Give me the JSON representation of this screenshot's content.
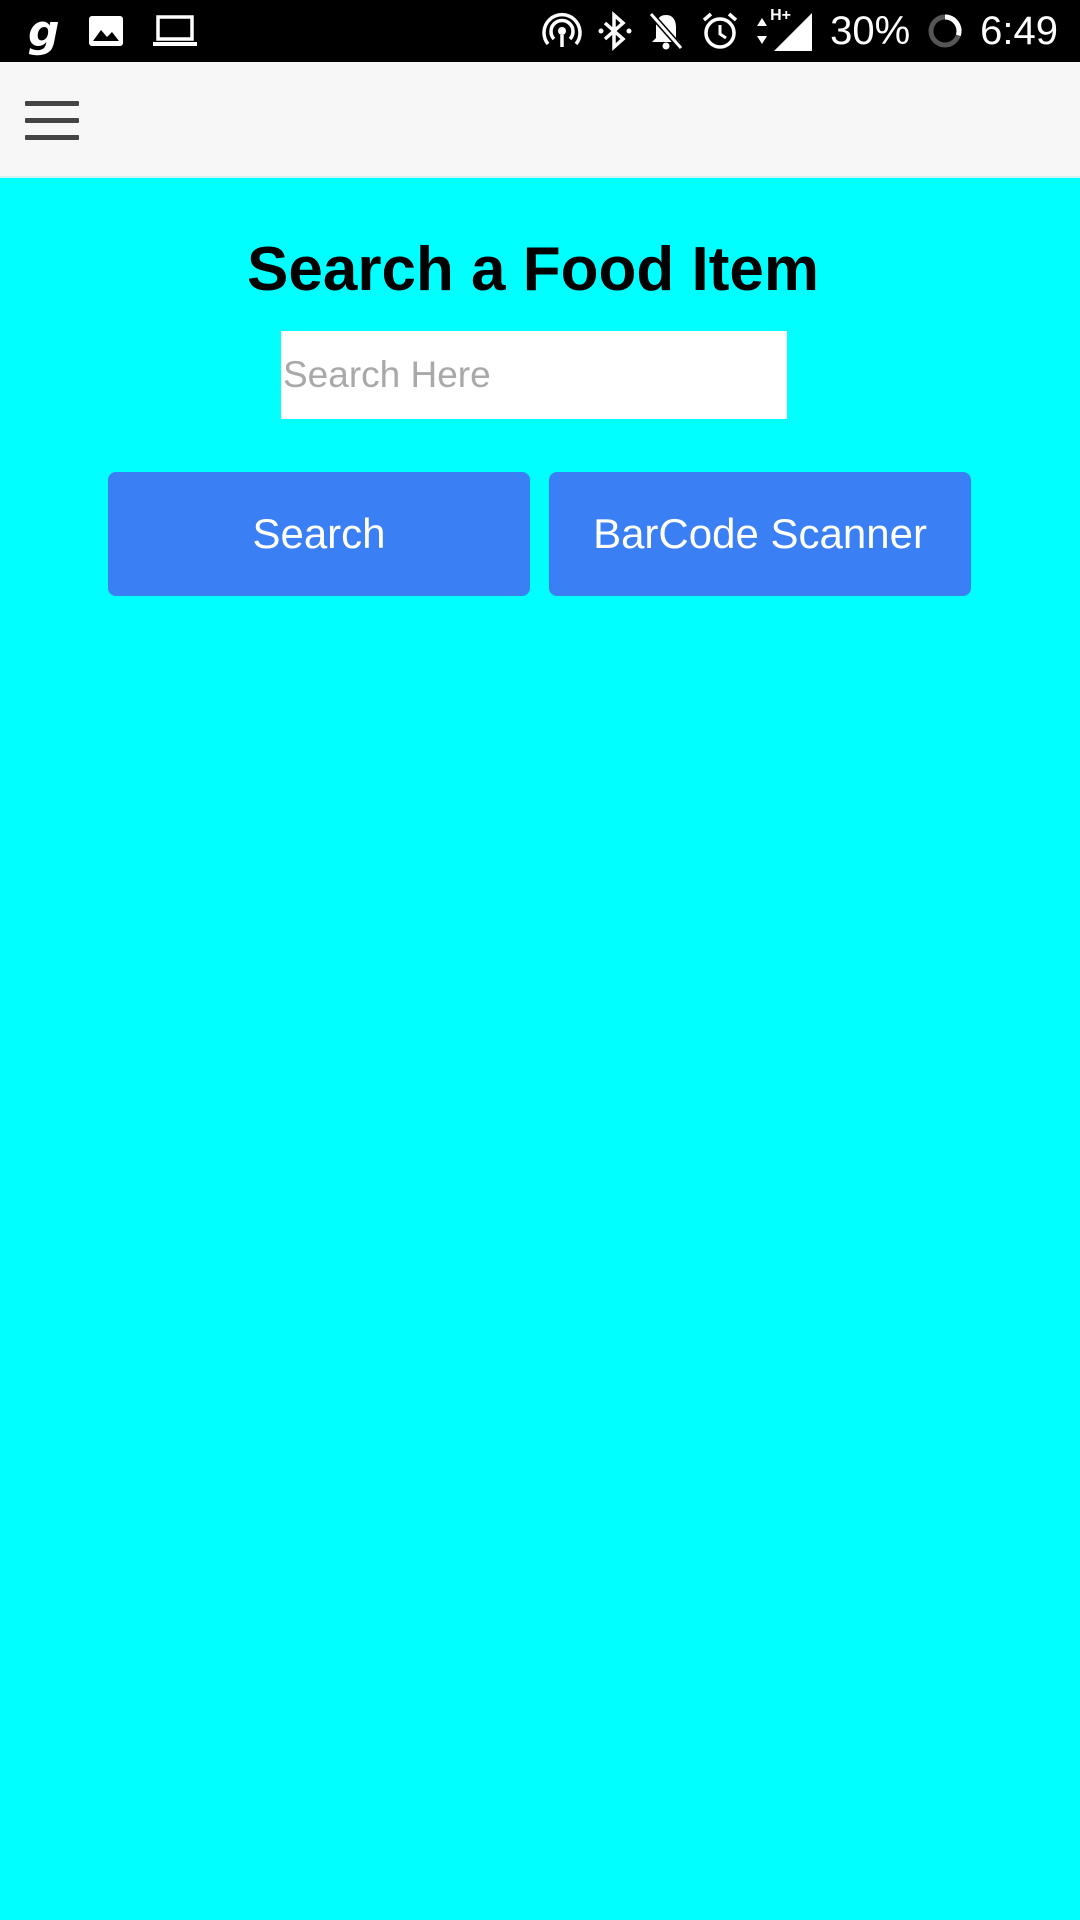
{
  "status_bar": {
    "left_icons": [
      "g-app-icon",
      "image-icon",
      "laptop-icon"
    ],
    "right_icons": [
      "hotspot-icon",
      "bluetooth-icon",
      "notifications-off-icon",
      "alarm-icon",
      "data-arrows-icon",
      "signal-icon",
      "battery-ring-icon"
    ],
    "network_type": "H+",
    "battery_percent": "30%",
    "time": "6:49"
  },
  "app_bar": {
    "menu_icon": "hamburger-menu-icon",
    "background": "#F7F7F7"
  },
  "main": {
    "title": "Search a Food Item",
    "search": {
      "placeholder": "Search Here",
      "value": ""
    },
    "buttons": {
      "search_label": "Search",
      "barcode_label": "BarCode Scanner"
    }
  },
  "colors": {
    "page_background": "#00FFFF",
    "button_background": "#3B7FF5",
    "button_text": "#FFFFFF",
    "status_bar": "#000000"
  }
}
